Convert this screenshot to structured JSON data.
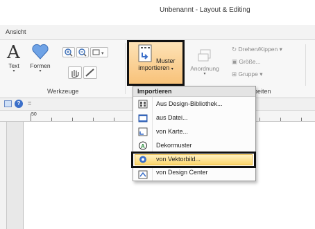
{
  "window": {
    "title": "Unbenannt - Layout & Editing"
  },
  "tabs": {
    "active": "Ansicht"
  },
  "ribbon": {
    "groups": {
      "werkzeuge": "Werkzeuge",
      "arbeiten": "beiten"
    },
    "text_label": "Text",
    "formen_label": "Formen",
    "muster_line1": "Muster",
    "muster_line2": "importieren",
    "anordnung_label": "Anordnung",
    "drehen_label": "Drehen/Kippen",
    "groesse_label": "Größe...",
    "gruppe_label": "Gruppe"
  },
  "ruler": {
    "mark": "50"
  },
  "menu": {
    "header": "Importieren",
    "items": [
      {
        "label": "Aus Design-Bibliothek...",
        "icon": "library-icon"
      },
      {
        "label": "aus Datei...",
        "icon": "folder-icon"
      },
      {
        "label": "von Karte...",
        "icon": "card-icon"
      },
      {
        "label": "Dekormuster",
        "icon": "decorative-icon"
      },
      {
        "label": "von Vektorbild...",
        "icon": "vector-icon"
      },
      {
        "label": "von Design Center",
        "icon": "design-center-icon"
      }
    ]
  },
  "colors": {
    "accent": "#f8c27a",
    "highlight": "#fbd56a",
    "icon_blue": "#3b6fc9"
  }
}
